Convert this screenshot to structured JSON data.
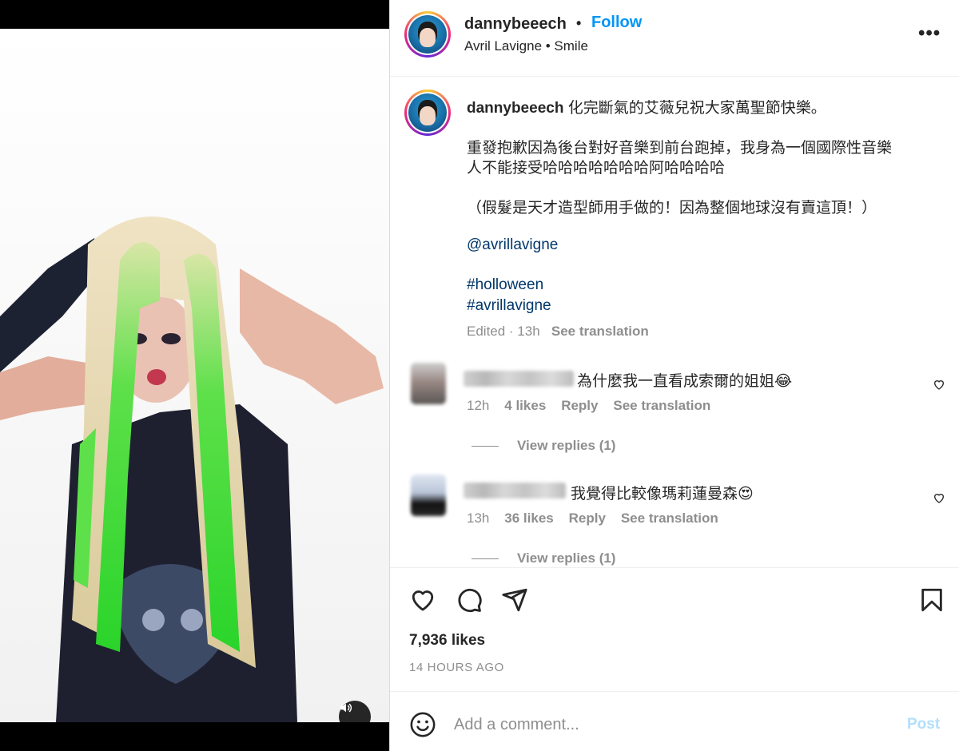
{
  "post": {
    "username": "dannybeeech",
    "separator": "•",
    "follow_label": "Follow",
    "audio": "Avril Lavigne • Smile",
    "more_label": "•••"
  },
  "caption": {
    "username": "dannybeeech",
    "line1": "化完斷氣的艾薇兒祝大家萬聖節快樂。",
    "line2": "重發抱歉因為後台對好音樂到前台跑掉，我身為一個國際性音樂",
    "line3": "人不能接受哈哈哈哈哈哈哈阿哈哈哈哈",
    "line4": "（假髮是天才造型師用手做的！因為整個地球沒有賣這頂！）",
    "mention": "@avrillavigne",
    "hashtag1": "#holloween",
    "hashtag2": "#avrillavigne",
    "edited": "Edited · 13h",
    "see_translation": "See translation"
  },
  "comments": [
    {
      "text": "為什麼我一直看成索爾的姐姐😂",
      "time": "12h",
      "likes": "4 likes",
      "reply": "Reply",
      "see_translation": "See translation",
      "view_replies": "View replies (1)"
    },
    {
      "text": "我覺得比較像瑪莉蓮曼森😍",
      "time": "13h",
      "likes": "36 likes",
      "reply": "Reply",
      "see_translation": "See translation",
      "view_replies": "View replies (1)"
    }
  ],
  "stats": {
    "likes": "7,936 likes",
    "time_ago": "14 HOURS AGO"
  },
  "composer": {
    "placeholder": "Add a comment...",
    "post_label": "Post"
  },
  "icons": {
    "heart": "heart-icon",
    "comment": "comment-icon",
    "share": "share-icon",
    "save": "bookmark-icon",
    "emoji": "emoji-icon",
    "speaker": "speaker-icon"
  },
  "colors": {
    "follow": "#0095f6",
    "link": "#00376b",
    "muted": "#8e8e8e",
    "post_disabled": "#b2dffc"
  }
}
